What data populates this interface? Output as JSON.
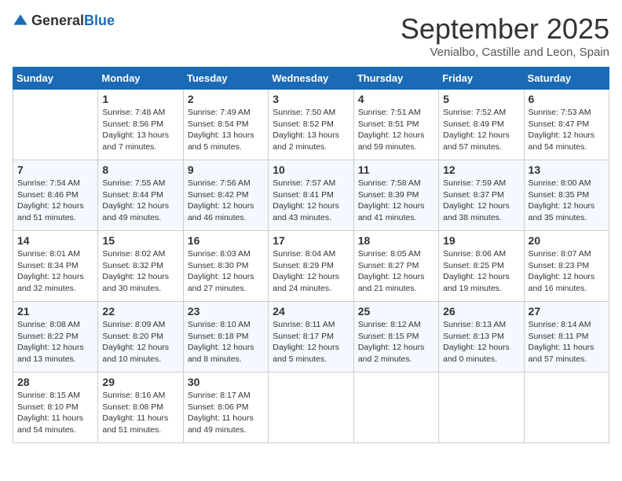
{
  "header": {
    "logo_general": "General",
    "logo_blue": "Blue",
    "month_title": "September 2025",
    "location": "Venialbo, Castille and Leon, Spain"
  },
  "days_of_week": [
    "Sunday",
    "Monday",
    "Tuesday",
    "Wednesday",
    "Thursday",
    "Friday",
    "Saturday"
  ],
  "weeks": [
    [
      {
        "day": "",
        "info": ""
      },
      {
        "day": "1",
        "info": "Sunrise: 7:48 AM\nSunset: 8:56 PM\nDaylight: 13 hours\nand 7 minutes."
      },
      {
        "day": "2",
        "info": "Sunrise: 7:49 AM\nSunset: 8:54 PM\nDaylight: 13 hours\nand 5 minutes."
      },
      {
        "day": "3",
        "info": "Sunrise: 7:50 AM\nSunset: 8:52 PM\nDaylight: 13 hours\nand 2 minutes."
      },
      {
        "day": "4",
        "info": "Sunrise: 7:51 AM\nSunset: 8:51 PM\nDaylight: 12 hours\nand 59 minutes."
      },
      {
        "day": "5",
        "info": "Sunrise: 7:52 AM\nSunset: 8:49 PM\nDaylight: 12 hours\nand 57 minutes."
      },
      {
        "day": "6",
        "info": "Sunrise: 7:53 AM\nSunset: 8:47 PM\nDaylight: 12 hours\nand 54 minutes."
      }
    ],
    [
      {
        "day": "7",
        "info": "Sunrise: 7:54 AM\nSunset: 8:46 PM\nDaylight: 12 hours\nand 51 minutes."
      },
      {
        "day": "8",
        "info": "Sunrise: 7:55 AM\nSunset: 8:44 PM\nDaylight: 12 hours\nand 49 minutes."
      },
      {
        "day": "9",
        "info": "Sunrise: 7:56 AM\nSunset: 8:42 PM\nDaylight: 12 hours\nand 46 minutes."
      },
      {
        "day": "10",
        "info": "Sunrise: 7:57 AM\nSunset: 8:41 PM\nDaylight: 12 hours\nand 43 minutes."
      },
      {
        "day": "11",
        "info": "Sunrise: 7:58 AM\nSunset: 8:39 PM\nDaylight: 12 hours\nand 41 minutes."
      },
      {
        "day": "12",
        "info": "Sunrise: 7:59 AM\nSunset: 8:37 PM\nDaylight: 12 hours\nand 38 minutes."
      },
      {
        "day": "13",
        "info": "Sunrise: 8:00 AM\nSunset: 8:35 PM\nDaylight: 12 hours\nand 35 minutes."
      }
    ],
    [
      {
        "day": "14",
        "info": "Sunrise: 8:01 AM\nSunset: 8:34 PM\nDaylight: 12 hours\nand 32 minutes."
      },
      {
        "day": "15",
        "info": "Sunrise: 8:02 AM\nSunset: 8:32 PM\nDaylight: 12 hours\nand 30 minutes."
      },
      {
        "day": "16",
        "info": "Sunrise: 8:03 AM\nSunset: 8:30 PM\nDaylight: 12 hours\nand 27 minutes."
      },
      {
        "day": "17",
        "info": "Sunrise: 8:04 AM\nSunset: 8:29 PM\nDaylight: 12 hours\nand 24 minutes."
      },
      {
        "day": "18",
        "info": "Sunrise: 8:05 AM\nSunset: 8:27 PM\nDaylight: 12 hours\nand 21 minutes."
      },
      {
        "day": "19",
        "info": "Sunrise: 8:06 AM\nSunset: 8:25 PM\nDaylight: 12 hours\nand 19 minutes."
      },
      {
        "day": "20",
        "info": "Sunrise: 8:07 AM\nSunset: 8:23 PM\nDaylight: 12 hours\nand 16 minutes."
      }
    ],
    [
      {
        "day": "21",
        "info": "Sunrise: 8:08 AM\nSunset: 8:22 PM\nDaylight: 12 hours\nand 13 minutes."
      },
      {
        "day": "22",
        "info": "Sunrise: 8:09 AM\nSunset: 8:20 PM\nDaylight: 12 hours\nand 10 minutes."
      },
      {
        "day": "23",
        "info": "Sunrise: 8:10 AM\nSunset: 8:18 PM\nDaylight: 12 hours\nand 8 minutes."
      },
      {
        "day": "24",
        "info": "Sunrise: 8:11 AM\nSunset: 8:17 PM\nDaylight: 12 hours\nand 5 minutes."
      },
      {
        "day": "25",
        "info": "Sunrise: 8:12 AM\nSunset: 8:15 PM\nDaylight: 12 hours\nand 2 minutes."
      },
      {
        "day": "26",
        "info": "Sunrise: 8:13 AM\nSunset: 8:13 PM\nDaylight: 12 hours\nand 0 minutes."
      },
      {
        "day": "27",
        "info": "Sunrise: 8:14 AM\nSunset: 8:11 PM\nDaylight: 11 hours\nand 57 minutes."
      }
    ],
    [
      {
        "day": "28",
        "info": "Sunrise: 8:15 AM\nSunset: 8:10 PM\nDaylight: 11 hours\nand 54 minutes."
      },
      {
        "day": "29",
        "info": "Sunrise: 8:16 AM\nSunset: 8:08 PM\nDaylight: 11 hours\nand 51 minutes."
      },
      {
        "day": "30",
        "info": "Sunrise: 8:17 AM\nSunset: 8:06 PM\nDaylight: 11 hours\nand 49 minutes."
      },
      {
        "day": "",
        "info": ""
      },
      {
        "day": "",
        "info": ""
      },
      {
        "day": "",
        "info": ""
      },
      {
        "day": "",
        "info": ""
      }
    ]
  ]
}
